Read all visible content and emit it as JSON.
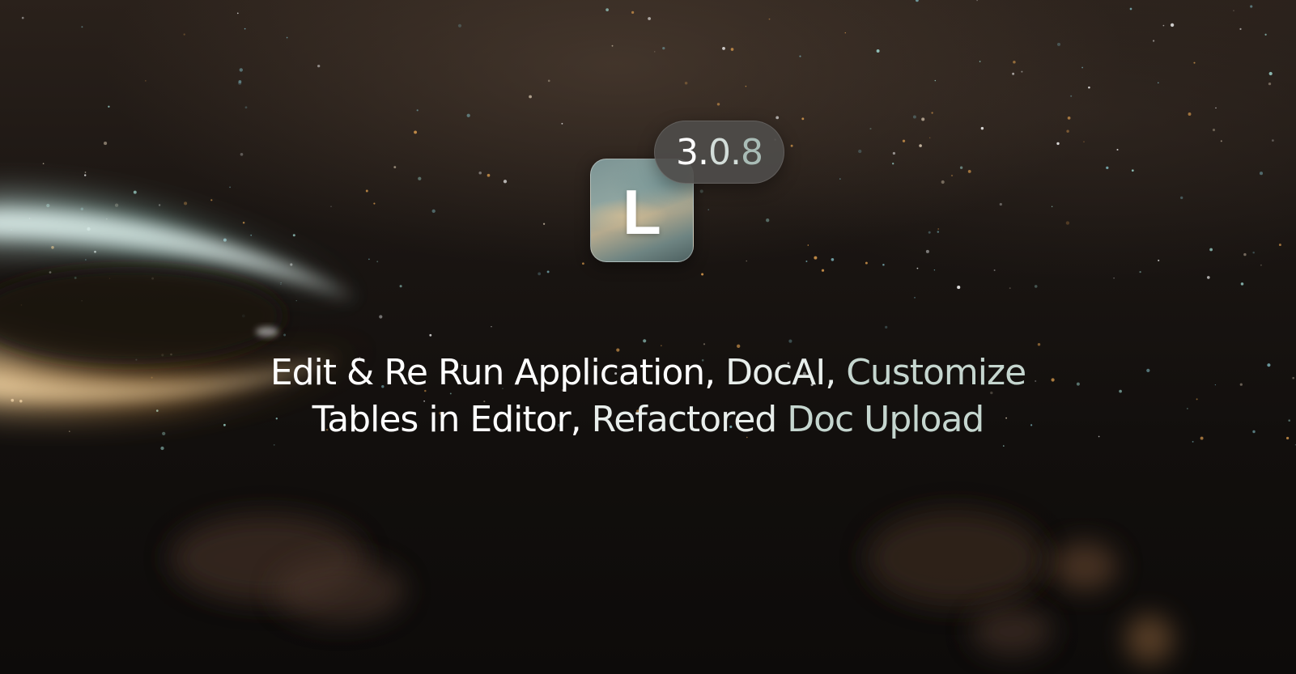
{
  "background": {
    "description_icon": "space-nebula-background",
    "accent_colors": [
      "#2a211b",
      "#9fd8d0",
      "#e0a050",
      "#120f0d"
    ]
  },
  "logo": {
    "letter": "L",
    "icon": "app-logo-icon"
  },
  "version": {
    "major": "3.",
    "minor": "0.",
    "patch": "8"
  },
  "headline": {
    "line1": {
      "part1": "Edit & Re Run Application, ",
      "part2": "DocAI, ",
      "part3": "Customize"
    },
    "line2": {
      "part1": "Tables in Editor, ",
      "part2": "Refactored ",
      "part3": "Doc Upload"
    }
  }
}
